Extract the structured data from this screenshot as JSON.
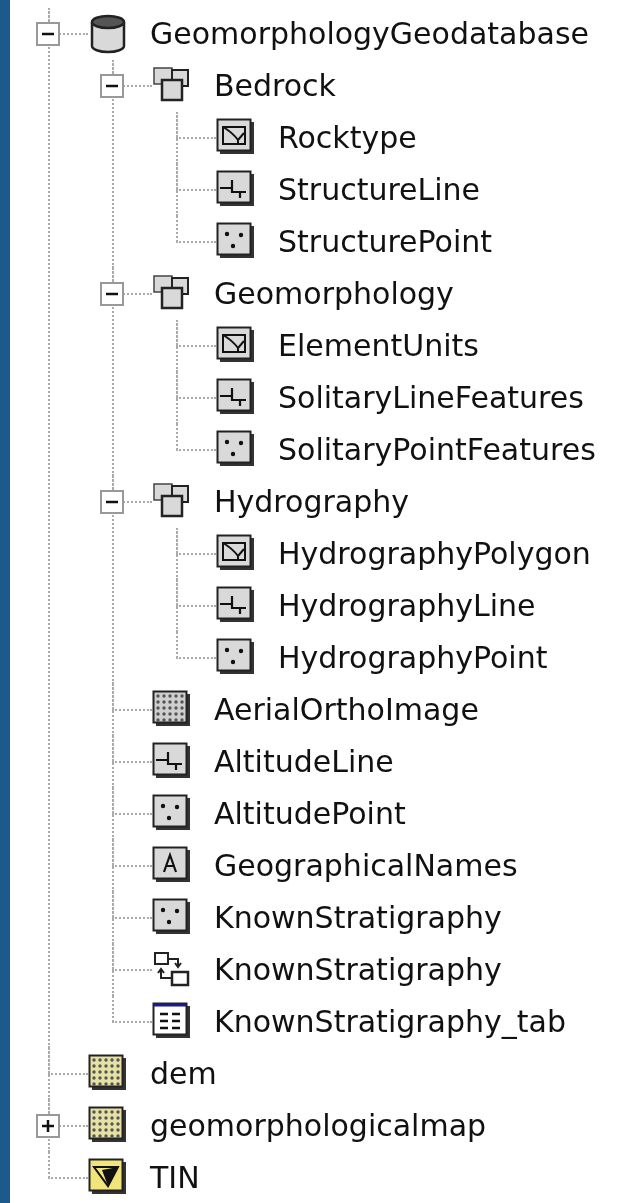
{
  "tree": [
    {
      "label": "GeomorphologyGeodatabase",
      "kind": "geodatabase",
      "expanded": true,
      "children": [
        {
          "label": "Bedrock",
          "kind": "dataset",
          "expanded": true,
          "children": [
            {
              "label": "Rocktype",
              "kind": "polygon"
            },
            {
              "label": "StructureLine",
              "kind": "line"
            },
            {
              "label": "StructurePoint",
              "kind": "point"
            }
          ]
        },
        {
          "label": "Geomorphology",
          "kind": "dataset",
          "expanded": true,
          "children": [
            {
              "label": "ElementUnits",
              "kind": "polygon"
            },
            {
              "label": "SolitaryLineFeatures",
              "kind": "line"
            },
            {
              "label": "SolitaryPointFeatures",
              "kind": "point"
            }
          ]
        },
        {
          "label": "Hydrography",
          "kind": "dataset",
          "expanded": true,
          "children": [
            {
              "label": "HydrographyPolygon",
              "kind": "polygon"
            },
            {
              "label": "HydrographyLine",
              "kind": "line"
            },
            {
              "label": "HydrographyPoint",
              "kind": "point"
            }
          ]
        },
        {
          "label": "AerialOrthoImage",
          "kind": "raster"
        },
        {
          "label": "AltitudeLine",
          "kind": "line"
        },
        {
          "label": "AltitudePoint",
          "kind": "point"
        },
        {
          "label": "GeographicalNames",
          "kind": "annotation"
        },
        {
          "label": "KnownStratigraphy",
          "kind": "point"
        },
        {
          "label": "KnownStratigraphy",
          "kind": "relationship"
        },
        {
          "label": "KnownStratigraphy_tab",
          "kind": "table"
        }
      ]
    },
    {
      "label": "dem",
      "kind": "raster_dataset"
    },
    {
      "label": "geomorphologicalmap",
      "kind": "raster_dataset",
      "expanded": false
    },
    {
      "label": "TIN",
      "kind": "tin"
    }
  ]
}
